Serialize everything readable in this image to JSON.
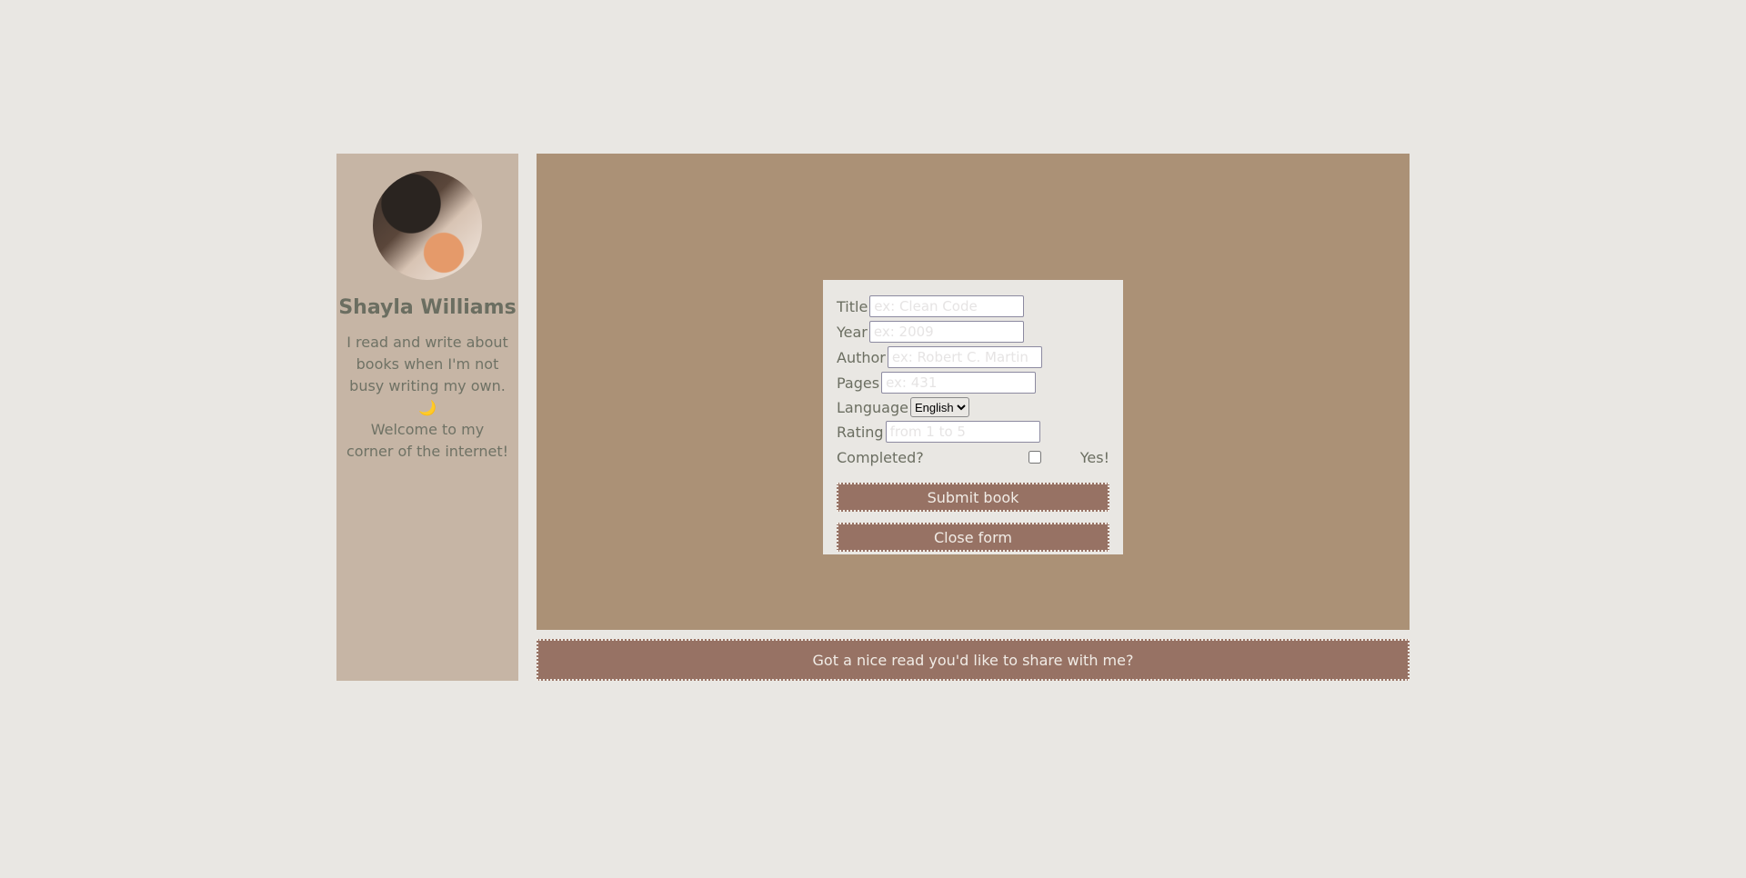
{
  "profile": {
    "name": "Shayla Williams",
    "bio_line1": "I read and write about books when I'm not busy writing my own.",
    "emoji": "🌙",
    "bio_line2": "Welcome to my corner of the internet!"
  },
  "form": {
    "title_label": "Title",
    "title_placeholder": "ex: Clean Code",
    "year_label": "Year",
    "year_placeholder": "ex: 2009",
    "author_label": "Author",
    "author_placeholder": "ex: Robert C. Martin",
    "pages_label": "Pages",
    "pages_placeholder": "ex: 431",
    "language_label": "Language",
    "language_value": "English",
    "rating_label": "Rating",
    "rating_placeholder": "from 1 to 5",
    "completed_label": "Completed?",
    "completed_checked": false,
    "completed_yes": "Yes!",
    "submit_label": "Submit book",
    "close_label": "Close form"
  },
  "share_button": "Got a nice read you'd like to share with me?",
  "colors": {
    "background": "#e9e7e3",
    "sidebar": "#c6b5a5",
    "main": "#ab9176",
    "button": "#977264",
    "text": "#6b6e61"
  }
}
